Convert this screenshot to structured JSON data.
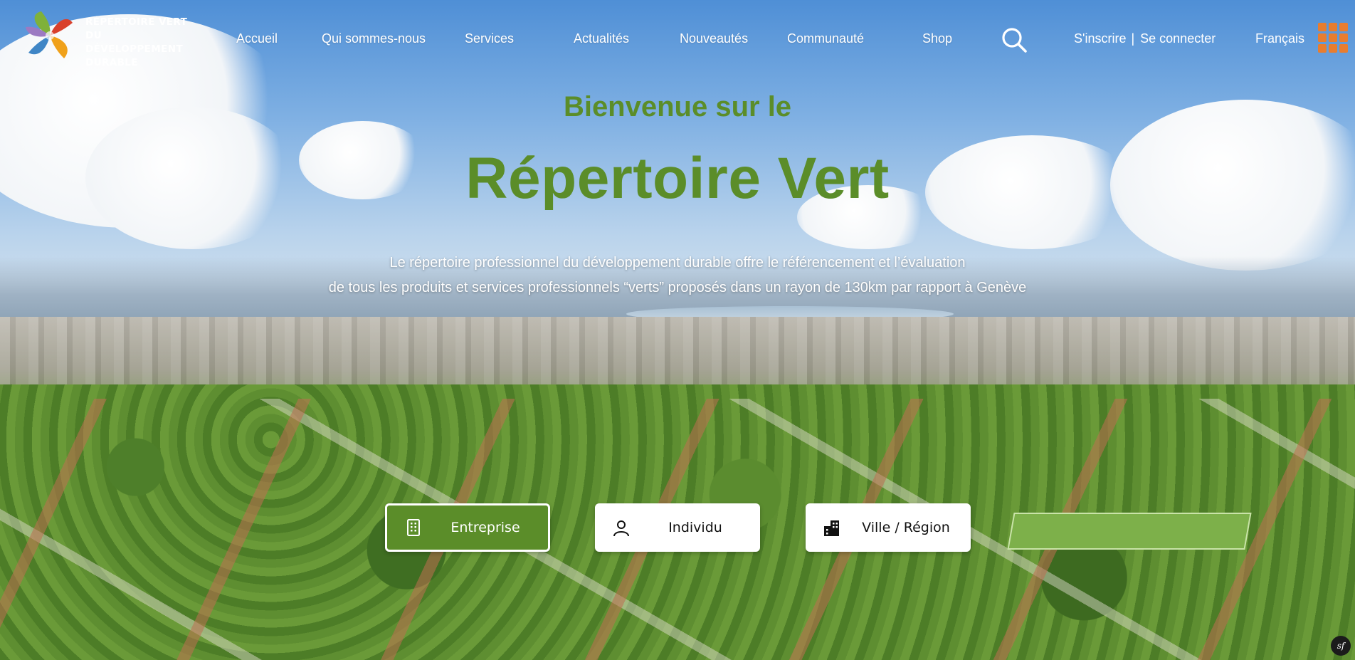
{
  "brand": {
    "line1": "RÉPERTOIRE VERT",
    "line2": "DU DÉVELOPPEMENT",
    "line3": "DURABLE"
  },
  "nav": {
    "items": [
      {
        "label": "Accueil"
      },
      {
        "label": "Qui sommes-nous"
      },
      {
        "label": "Services"
      },
      {
        "label": "Actualités"
      },
      {
        "label": "Nouveautés"
      },
      {
        "label": "Communauté"
      },
      {
        "label": "Shop"
      }
    ],
    "search_icon": "search-icon",
    "signup": "S'inscrire",
    "separator": "|",
    "login": "Se connecter",
    "language": "Français",
    "menu_icon": "grid-menu-icon"
  },
  "hero": {
    "welcome": "Bienvenue sur le",
    "title": "Répertoire Vert",
    "description_line1": "Le répertoire professionnel du développement durable offre le référencement et l’évaluation",
    "description_line2": "de tous les produits et services professionnels “verts” proposés dans un rayon de 130km par rapport à Genève"
  },
  "choices": [
    {
      "label": "Entreprise",
      "icon": "building-icon",
      "selected": true
    },
    {
      "label": "Individu",
      "icon": "user-icon",
      "selected": false
    },
    {
      "label": "Ville / Région",
      "icon": "city-icon",
      "selected": false
    }
  ],
  "badge": {
    "text": "sf"
  },
  "colors": {
    "brand_green": "#5b8d29",
    "accent_orange": "#e87d2f",
    "text_white": "#ffffff"
  }
}
